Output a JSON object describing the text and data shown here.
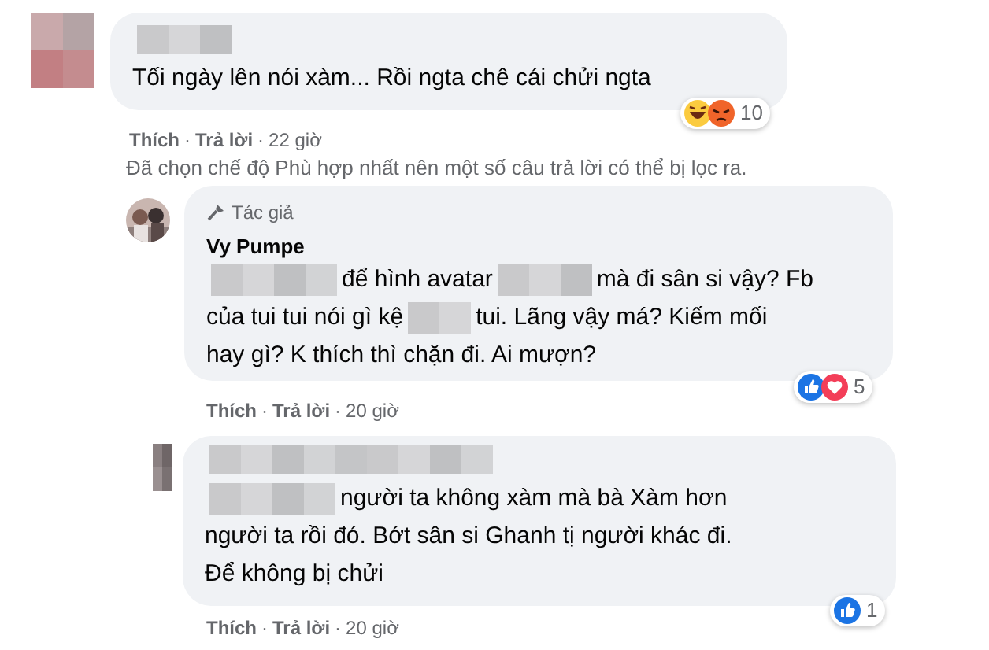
{
  "comments": [
    {
      "body": [
        [
          {
            "kind": "text",
            "text": "Tối ngày lên nói xàm... Rồi ngta chê cái chửi ngta"
          }
        ]
      ],
      "reactions": {
        "icons": [
          {
            "kind": "haha"
          },
          {
            "kind": "angry"
          }
        ],
        "count": "10"
      },
      "actions": [
        "Thích",
        "Trả lời"
      ],
      "separator": "·",
      "time": "22 giờ",
      "notice": "Đã chọn chế độ Phù hợp nhất nên một số câu trả lời có thể bị lọc ra."
    },
    {
      "author": "Vy Pumpe",
      "author_badge": "Tác giả",
      "body": [
        [
          {
            "kind": "redaction-wide"
          },
          {
            "kind": "text",
            "text": "để hình avatar"
          },
          {
            "kind": "redaction"
          },
          {
            "kind": "text",
            "text": "mà đi sân si vậy? Fb"
          }
        ],
        [
          {
            "kind": "text",
            "text": "của tui tui nói gì kệ"
          },
          {
            "kind": "redaction-short"
          },
          {
            "kind": "text",
            "text": "tui. Lãng vậy má? Kiếm mối"
          }
        ],
        [
          {
            "kind": "text",
            "text": "hay gì? K thích thì chặn đi. Ai mượn?"
          }
        ]
      ],
      "reactions": {
        "icons": [
          {
            "kind": "like"
          },
          {
            "kind": "love"
          }
        ],
        "count": "5"
      },
      "actions": [
        "Thích",
        "Trả lời"
      ],
      "separator": "·",
      "time": "20 giờ"
    },
    {
      "body": [
        [
          {
            "kind": "redaction-wide"
          },
          {
            "kind": "text",
            "text": "người ta không xàm mà bà Xàm hơn"
          }
        ],
        [
          {
            "kind": "text",
            "text": "người ta rồi đó. Bớt sân si Ghanh tị người khác đi."
          }
        ],
        [
          {
            "kind": "text",
            "text": "Để không bị chửi"
          }
        ]
      ],
      "reactions": {
        "icons": [
          {
            "kind": "like"
          }
        ],
        "count": "1"
      },
      "actions": [
        "Thích",
        "Trả lời"
      ],
      "separator": "·",
      "time": "20 giờ"
    }
  ]
}
